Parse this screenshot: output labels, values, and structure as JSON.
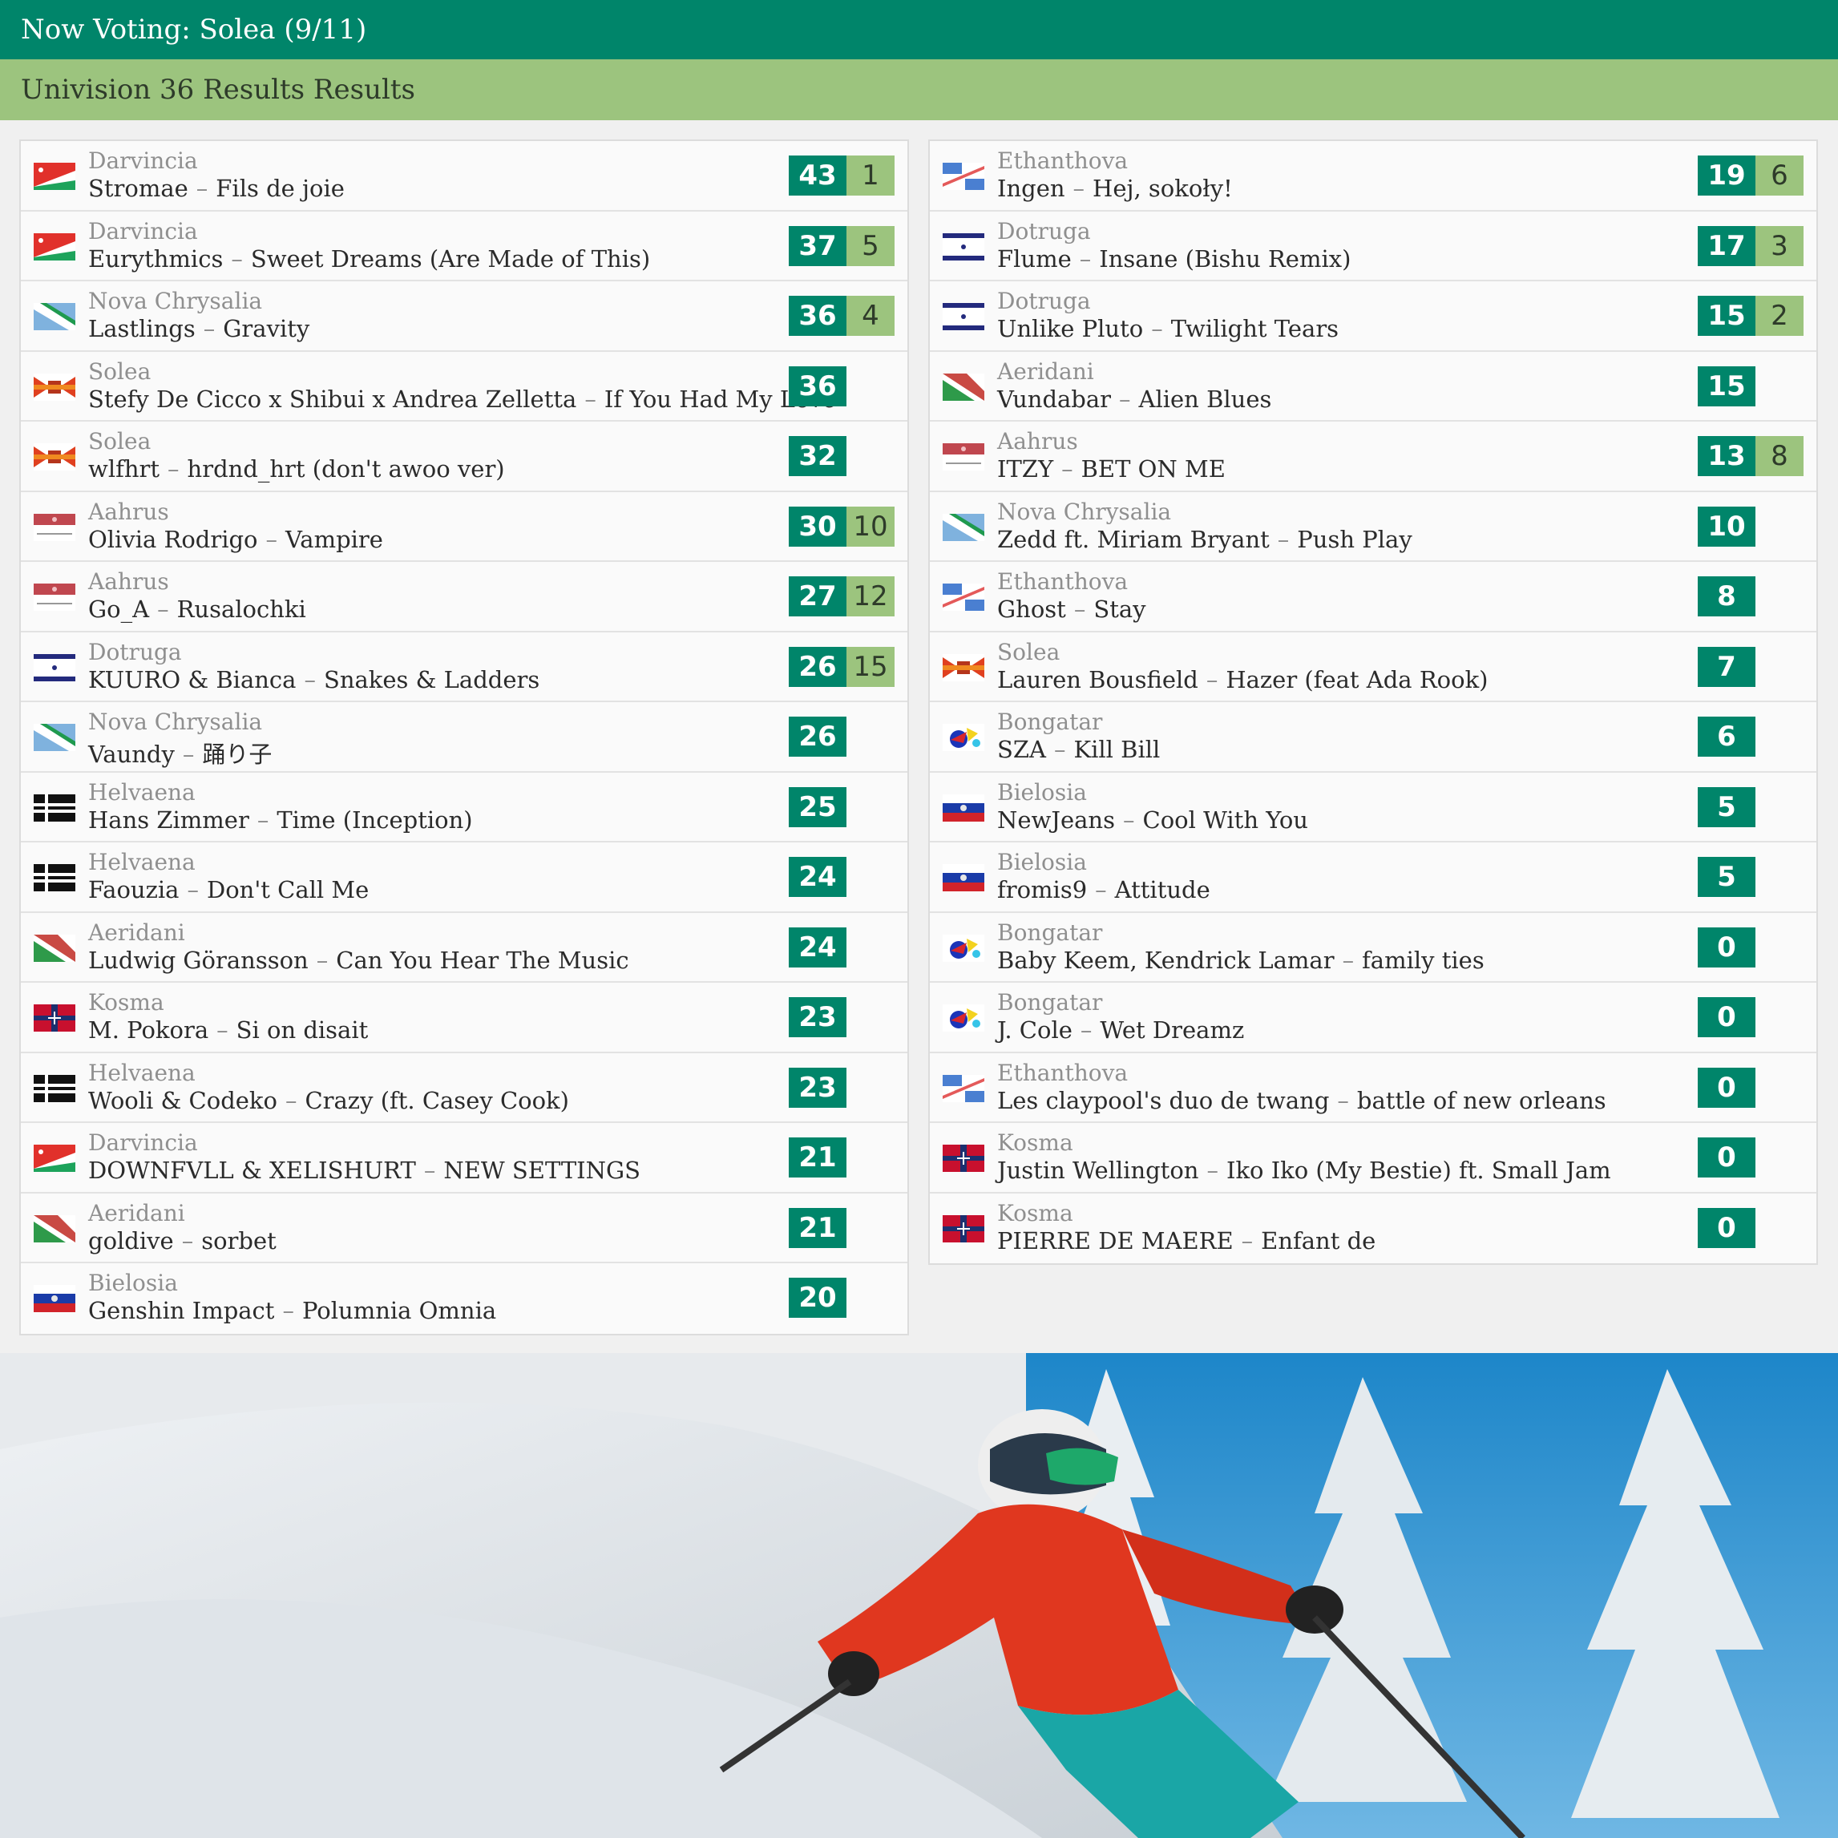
{
  "header": {
    "title": "Now Voting: Solea (9/11)"
  },
  "subheader": {
    "title": "Univision 36 Results Results"
  },
  "left_entries": [
    {
      "country": "Darvincia",
      "artist": "Stromae",
      "song": "Fils de joie",
      "points": "43",
      "jury": "1"
    },
    {
      "country": "Darvincia",
      "artist": "Eurythmics",
      "song": "Sweet Dreams (Are Made of This)",
      "points": "37",
      "jury": "5"
    },
    {
      "country": "Nova Chrysalia",
      "artist": "Lastlings",
      "song": "Gravity",
      "points": "36",
      "jury": "4"
    },
    {
      "country": "Solea",
      "artist": "Stefy De Cicco x Shibui x Andrea Zelletta",
      "song": "If You Had My Love",
      "points": "36",
      "jury": ""
    },
    {
      "country": "Solea",
      "artist": "wlfhrt",
      "song": "hrdnd_hrt (don't awoo ver)",
      "points": "32",
      "jury": ""
    },
    {
      "country": "Aahrus",
      "artist": "Olivia Rodrigo",
      "song": "Vampire",
      "points": "30",
      "jury": "10"
    },
    {
      "country": "Aahrus",
      "artist": "Go_A",
      "song": "Rusalochki",
      "points": "27",
      "jury": "12"
    },
    {
      "country": "Dotruga",
      "artist": "KUURO & Bianca",
      "song": "Snakes & Ladders",
      "points": "26",
      "jury": "15"
    },
    {
      "country": "Nova Chrysalia",
      "artist": "Vaundy",
      "song": "踊り子",
      "points": "26",
      "jury": ""
    },
    {
      "country": "Helvaena",
      "artist": "Hans Zimmer",
      "song": "Time (Inception)",
      "points": "25",
      "jury": ""
    },
    {
      "country": "Helvaena",
      "artist": "Faouzia",
      "song": "Don't Call Me",
      "points": "24",
      "jury": ""
    },
    {
      "country": "Aeridani",
      "artist": "Ludwig Göransson",
      "song": "Can You Hear The Music",
      "points": "24",
      "jury": ""
    },
    {
      "country": "Kosma",
      "artist": "M. Pokora",
      "song": "Si on disait",
      "points": "23",
      "jury": ""
    },
    {
      "country": "Helvaena",
      "artist": "Wooli & Codeko",
      "song": "Crazy (ft. Casey Cook)",
      "points": "23",
      "jury": ""
    },
    {
      "country": "Darvincia",
      "artist": "DOWNFVLL & XELISHURT",
      "song": "NEW SETTINGS",
      "points": "21",
      "jury": ""
    },
    {
      "country": "Aeridani",
      "artist": "goldive",
      "song": "sorbet",
      "points": "21",
      "jury": ""
    },
    {
      "country": "Bielosia",
      "artist": "Genshin Impact",
      "song": "Polumnia Omnia",
      "points": "20",
      "jury": ""
    }
  ],
  "right_entries": [
    {
      "country": "Ethanthova",
      "artist": "Ingen",
      "song": "Hej, sokoły!",
      "points": "19",
      "jury": "6"
    },
    {
      "country": "Dotruga",
      "artist": "Flume",
      "song": "Insane (Bishu Remix)",
      "points": "17",
      "jury": "3"
    },
    {
      "country": "Dotruga",
      "artist": "Unlike Pluto",
      "song": "Twilight Tears",
      "points": "15",
      "jury": "2"
    },
    {
      "country": "Aeridani",
      "artist": "Vundabar",
      "song": "Alien Blues",
      "points": "15",
      "jury": ""
    },
    {
      "country": "Aahrus",
      "artist": "ITZY",
      "song": "BET ON ME",
      "points": "13",
      "jury": "8"
    },
    {
      "country": "Nova Chrysalia",
      "artist": "Zedd ft. Miriam Bryant",
      "song": "Push Play",
      "points": "10",
      "jury": ""
    },
    {
      "country": "Ethanthova",
      "artist": "Ghost",
      "song": "Stay",
      "points": "8",
      "jury": ""
    },
    {
      "country": "Solea",
      "artist": "Lauren Bousfield",
      "song": "Hazer (feat Ada Rook)",
      "points": "7",
      "jury": ""
    },
    {
      "country": "Bongatar",
      "artist": "SZA",
      "song": "Kill Bill",
      "points": "6",
      "jury": ""
    },
    {
      "country": "Bielosia",
      "artist": "NewJeans",
      "song": "Cool With You",
      "points": "5",
      "jury": ""
    },
    {
      "country": "Bielosia",
      "artist": "fromis9",
      "song": "Attitude",
      "points": "5",
      "jury": ""
    },
    {
      "country": "Bongatar",
      "artist": "Baby Keem, Kendrick Lamar",
      "song": "family ties",
      "points": "0",
      "jury": ""
    },
    {
      "country": "Bongatar",
      "artist": "J. Cole",
      "song": "Wet Dreamz",
      "points": "0",
      "jury": ""
    },
    {
      "country": "Ethanthova",
      "artist": "Les claypool's duo de twang",
      "song": "battle of new orleans",
      "points": "0",
      "jury": ""
    },
    {
      "country": "Kosma",
      "artist": "Justin Wellington",
      "song": "Iko Iko (My Bestie) ft. Small Jam",
      "points": "0",
      "jury": ""
    },
    {
      "country": "Kosma",
      "artist": "PIERRE DE MAERE",
      "song": "Enfant de",
      "points": "0",
      "jury": ""
    }
  ],
  "separator": "–",
  "colors": {
    "brand_green": "#00856a",
    "light_green": "#9cc47e"
  }
}
